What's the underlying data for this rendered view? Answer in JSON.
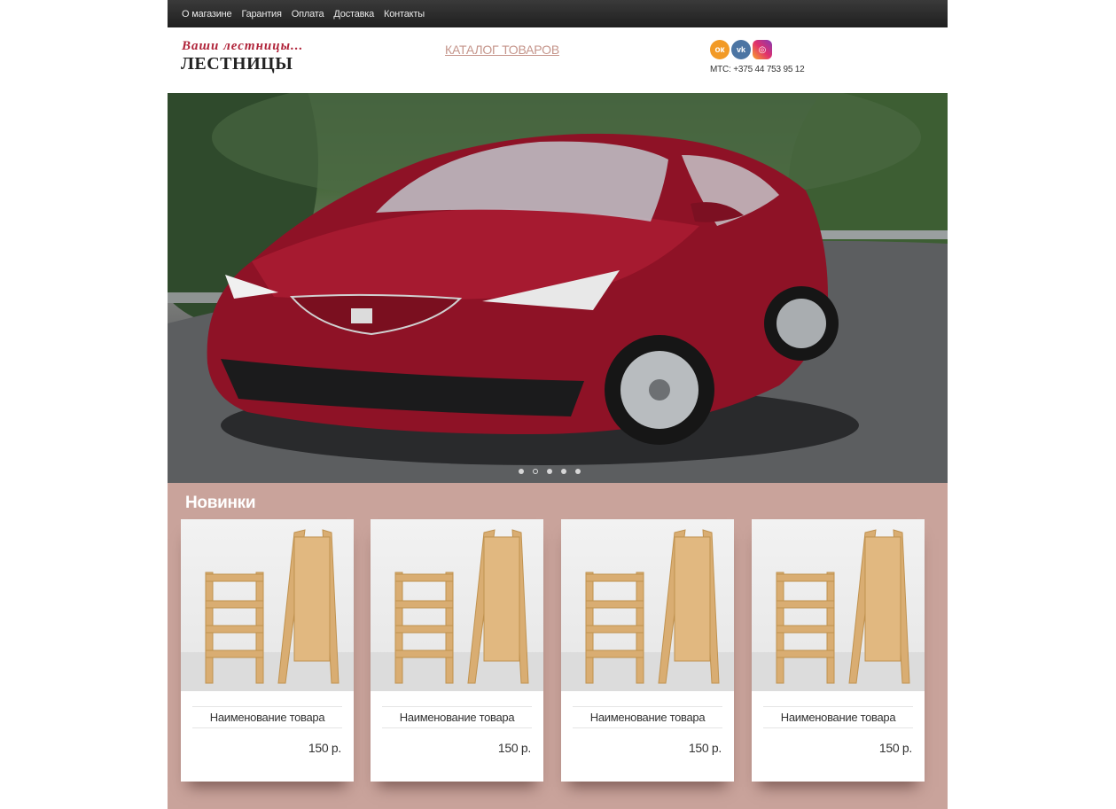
{
  "nav": {
    "items": [
      "О магазине",
      "Гарантия",
      "Оплата",
      "Доставка",
      "Контакты"
    ]
  },
  "header": {
    "tagline": "Ваши лестницы...",
    "brand": "ЛЕСТНИЦЫ",
    "catalog_link": "КАТАЛОГ ТОВАРОВ",
    "phone": "МТС: +375 44 753 95 12"
  },
  "socials": [
    {
      "name": "odnoklassniki",
      "glyph": "ок"
    },
    {
      "name": "vkontakte",
      "glyph": "vk"
    },
    {
      "name": "instagram",
      "glyph": "◎"
    }
  ],
  "slider": {
    "slide_count": 5,
    "active_index": 1
  },
  "news": {
    "title": "Новинки",
    "products": [
      {
        "name": "Наименование товара",
        "price": "150 р."
      },
      {
        "name": "Наименование товара",
        "price": "150 р."
      },
      {
        "name": "Наименование товара",
        "price": "150 р."
      },
      {
        "name": "Наименование товара",
        "price": "150 р."
      }
    ]
  },
  "colors": {
    "accent": "#c9a39b",
    "brand_red": "#b0243a",
    "nav_bg": "#2b2b2b"
  }
}
